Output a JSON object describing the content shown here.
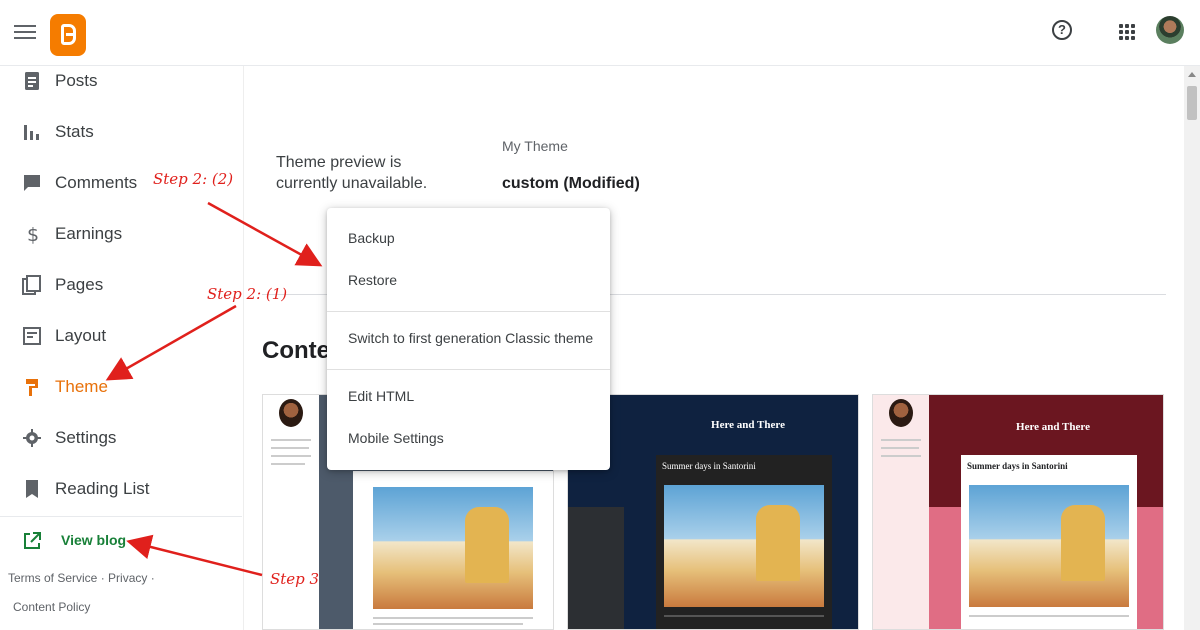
{
  "header": {
    "menu_icon": "hamburger-icon",
    "logo_icon": "blogger-logo-icon",
    "help_icon": "help-icon",
    "help_glyph": "?",
    "apps_icon": "apps-grid-icon",
    "avatar_icon": "account-avatar"
  },
  "sidebar": {
    "items": [
      {
        "label": "Posts",
        "icon": "posts-icon"
      },
      {
        "label": "Stats",
        "icon": "stats-icon"
      },
      {
        "label": "Comments",
        "icon": "comments-icon"
      },
      {
        "label": "Earnings",
        "icon": "dollar-icon"
      },
      {
        "label": "Pages",
        "icon": "pages-icon"
      },
      {
        "label": "Layout",
        "icon": "layout-icon"
      },
      {
        "label": "Theme",
        "icon": "theme-roller-icon",
        "active": true
      },
      {
        "label": "Settings",
        "icon": "gear-icon"
      },
      {
        "label": "Reading List",
        "icon": "bookmark-icon"
      }
    ],
    "view_blog": {
      "label": "View blog",
      "icon": "open-in-new-icon"
    },
    "footer": {
      "terms": "Terms of Service",
      "privacy": "Privacy",
      "content_policy": "Content Policy",
      "separator": "·"
    }
  },
  "main": {
    "preview_message": "Theme preview is currently unavailable.",
    "my_theme_label": "My Theme",
    "theme_name": "custom (Modified)",
    "contents_title": "Conten",
    "cards": [
      {
        "header": "",
        "post_title": ""
      },
      {
        "header": "Here and There",
        "post_title": "Summer days in Santorini"
      },
      {
        "header": "Here and There",
        "post_title": "Summer days in Santorini"
      }
    ]
  },
  "dropdown": {
    "items": [
      {
        "label": "Backup"
      },
      {
        "label": "Restore"
      },
      {
        "label": "Switch to first generation Classic theme"
      },
      {
        "label": "Edit HTML"
      },
      {
        "label": "Mobile Settings"
      }
    ]
  },
  "annotations": {
    "step_2_2": "Step 2: (2)",
    "step_2_1": "Step 2: (1)",
    "step_3": "Step 3"
  },
  "colors": {
    "accent_orange": "#e8710a",
    "link_green": "#188038",
    "annotation_red": "#e0201c"
  }
}
